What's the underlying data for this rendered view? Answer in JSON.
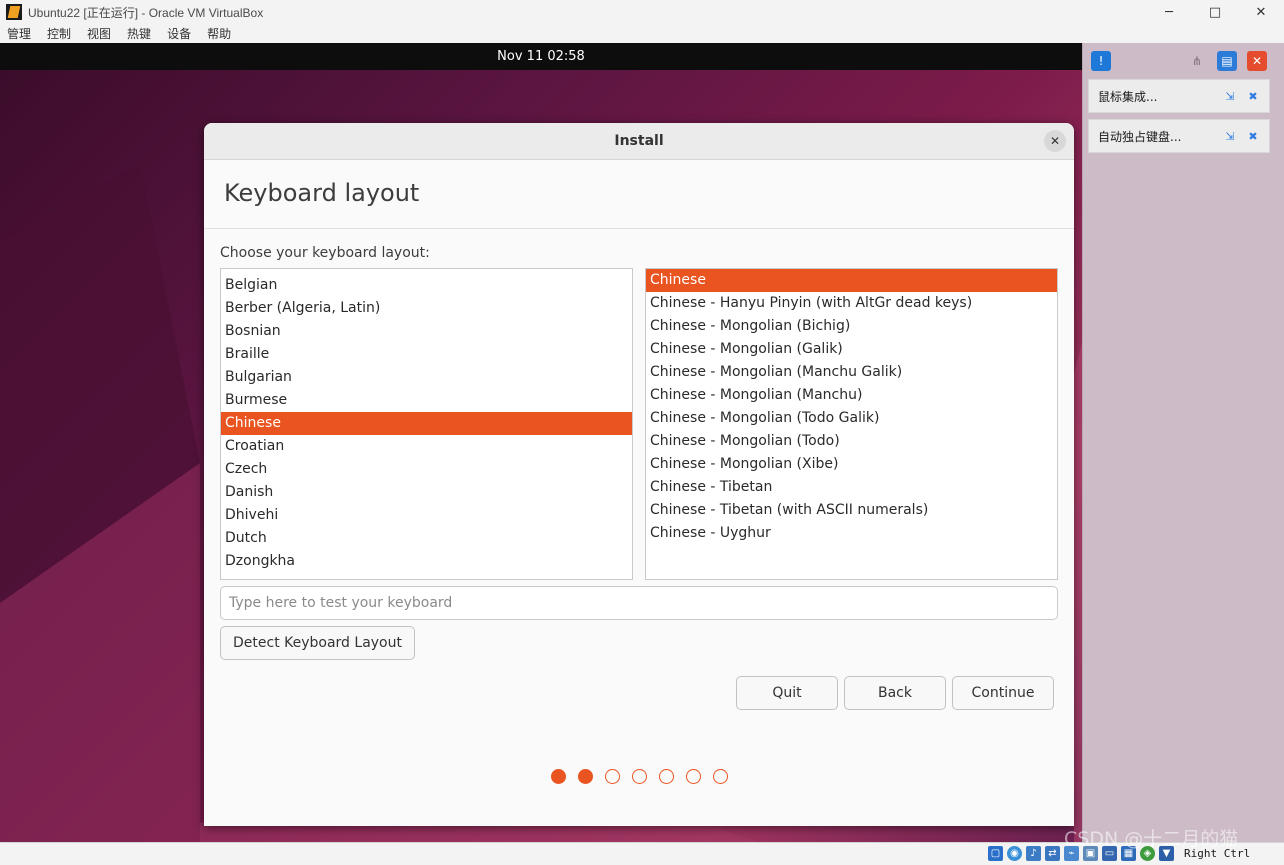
{
  "host_window": {
    "title": "Ubuntu22 [正在运行] - Oracle VM VirtualBox",
    "controls": {
      "minimize": "─",
      "maximize": "□",
      "close": "✕"
    },
    "menu": [
      "管理",
      "控制",
      "视图",
      "热键",
      "设备",
      "帮助"
    ]
  },
  "guest": {
    "clock": "Nov 11  02:58"
  },
  "dialog": {
    "title": "Install",
    "close_symbol": "✕",
    "heading": "Keyboard layout",
    "choose_label": "Choose your keyboard layout:",
    "left_list": {
      "items": [
        "Belgian",
        "Berber (Algeria, Latin)",
        "Bosnian",
        "Braille",
        "Bulgarian",
        "Burmese",
        "Chinese",
        "Croatian",
        "Czech",
        "Danish",
        "Dhivehi",
        "Dutch",
        "Dzongkha"
      ],
      "selected": "Chinese"
    },
    "right_list": {
      "items": [
        "Chinese",
        "Chinese - Hanyu Pinyin (with AltGr dead keys)",
        "Chinese - Mongolian (Bichig)",
        "Chinese - Mongolian (Galik)",
        "Chinese - Mongolian (Manchu Galik)",
        "Chinese - Mongolian (Manchu)",
        "Chinese - Mongolian (Todo Galik)",
        "Chinese - Mongolian (Todo)",
        "Chinese - Mongolian (Xibe)",
        "Chinese - Tibetan",
        "Chinese - Tibetan (with ASCII numerals)",
        "Chinese - Uyghur"
      ],
      "selected": "Chinese"
    },
    "test_input": {
      "value": "",
      "placeholder": "Type here to test your keyboard"
    },
    "detect_button": "Detect Keyboard Layout",
    "buttons": {
      "quit": "Quit",
      "back": "Back",
      "continue": "Continue"
    },
    "steps": {
      "total": 7,
      "completed": 2
    }
  },
  "vbox_panel": {
    "notifications": [
      {
        "text": "鼠标集成..."
      },
      {
        "text": "自动独占键盘..."
      }
    ]
  },
  "statusbar": {
    "host_key": "Right Ctrl",
    "watermark": "CSDN @十二月的猫"
  },
  "colors": {
    "accent": "#e95420",
    "titlebar": "#f3f3f3",
    "gnome_topbar": "#0d0d0d"
  }
}
